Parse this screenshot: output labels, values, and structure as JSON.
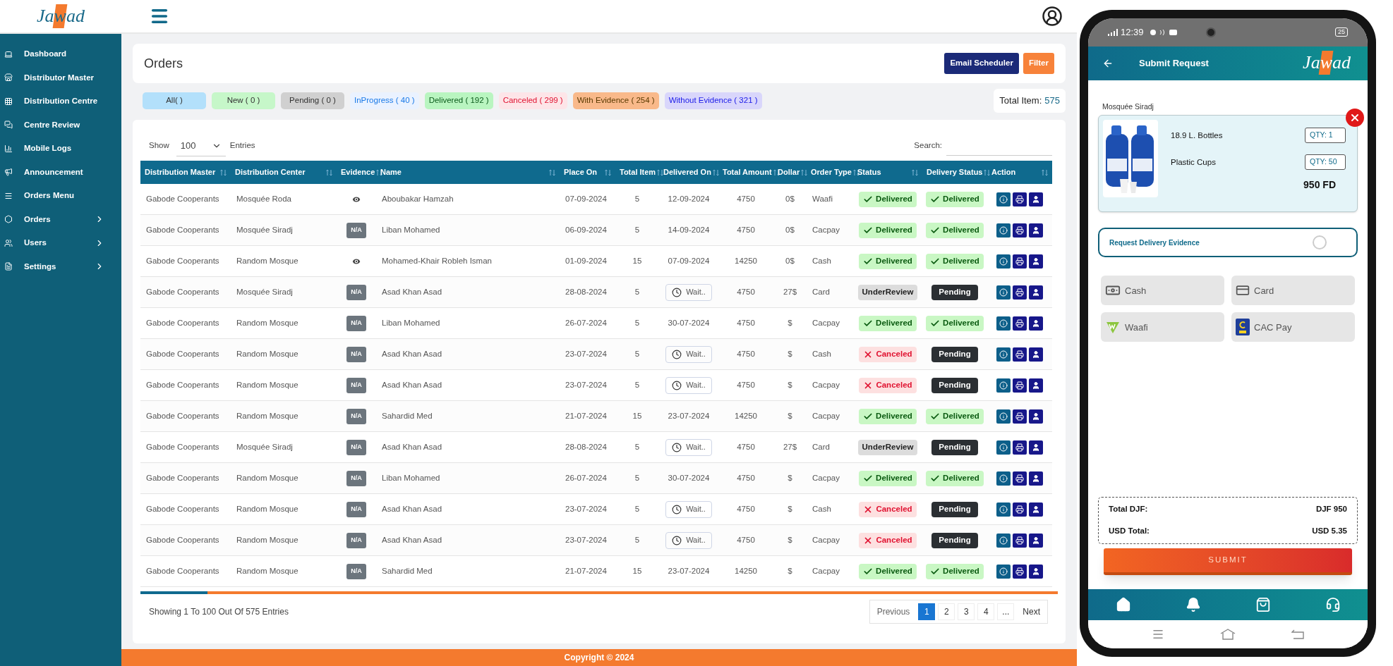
{
  "header": {
    "logo": "Jawad"
  },
  "sidebar": {
    "items": [
      {
        "label": "Dashboard",
        "kind": "link"
      },
      {
        "label": "Distributor Master",
        "kind": "link"
      },
      {
        "label": "Distribution Centre",
        "kind": "link"
      },
      {
        "label": "Centre Review",
        "kind": "link"
      },
      {
        "label": "Mobile Logs",
        "kind": "link"
      },
      {
        "label": "Announcement",
        "kind": "link"
      },
      {
        "label": "Orders Menu",
        "kind": "link"
      },
      {
        "label": "Orders",
        "kind": "submenu"
      },
      {
        "label": "Users",
        "kind": "submenu"
      },
      {
        "label": "Settings",
        "kind": "submenu"
      }
    ]
  },
  "page": {
    "title": "Orders",
    "buttons": [
      {
        "label": "Email Scheduler",
        "kind": "primary"
      },
      {
        "label": "Filter",
        "kind": "accent"
      }
    ]
  },
  "filters": [
    {
      "label": "All( )",
      "kind": "all"
    },
    {
      "label": "New ( 0 )",
      "kind": "new"
    },
    {
      "label": "Pending ( 0 )",
      "kind": "pending"
    },
    {
      "label": "InProgress ( 40 )",
      "kind": "inprogress"
    },
    {
      "label": "Delivered ( 192 )",
      "kind": "delivered"
    },
    {
      "label": "Canceled ( 299 )",
      "kind": "canceled"
    },
    {
      "label": "With Evidence ( 254 )",
      "kind": "with_evidence"
    },
    {
      "label": "Without Evidence ( 321 )",
      "kind": "without_evidence"
    }
  ],
  "total_item": {
    "label": "Total Item:",
    "value": "575"
  },
  "table_controls": {
    "show_label": "Show",
    "page_size": "100",
    "entries_label": "Entries",
    "search_label": "Search:"
  },
  "table": {
    "columns": [
      "Distribution Master",
      "Distribution Center",
      "Evidence",
      "Name",
      "Place On",
      "Total Item",
      "Delivered On",
      "Total Amount",
      "Dollar",
      "Order Type",
      "Status",
      "Delivery Status",
      "Action"
    ],
    "rows": [
      {
        "master": "Gabode Cooperants",
        "center": "Mosquée Roda",
        "evidence": {
          "kind": "eye"
        },
        "name": "Aboubakar Hamzah",
        "place_on": "07-09-2024",
        "total_item": "5",
        "delivered_on": {
          "kind": "date",
          "text": "12-09-2024"
        },
        "total_amount": "4750",
        "dollar": "0$",
        "order_type": "Waafi",
        "status": {
          "kind": "delivered",
          "text": "Delivered"
        },
        "delivery_status": {
          "kind": "delivered",
          "text": "Delivered"
        }
      },
      {
        "master": "Gabode Cooperants",
        "center": "Mosquée Siradj",
        "evidence": {
          "kind": "badge",
          "text": "N/A"
        },
        "name": "Liban Mohamed",
        "place_on": "06-09-2024",
        "total_item": "5",
        "delivered_on": {
          "kind": "date",
          "text": "14-09-2024"
        },
        "total_amount": "4750",
        "dollar": "0$",
        "order_type": "Cacpay",
        "status": {
          "kind": "delivered",
          "text": "Delivered"
        },
        "delivery_status": {
          "kind": "delivered",
          "text": "Delivered"
        }
      },
      {
        "master": "Gabode Cooperants",
        "center": "Random Mosque",
        "evidence": {
          "kind": "eye"
        },
        "name": "Mohamed-Khair Robleh Isman",
        "place_on": "01-09-2024",
        "total_item": "15",
        "delivered_on": {
          "kind": "date",
          "text": "07-09-2024"
        },
        "total_amount": "14250",
        "dollar": "0$",
        "order_type": "Cash",
        "status": {
          "kind": "delivered",
          "text": "Delivered"
        },
        "delivery_status": {
          "kind": "delivered",
          "text": "Delivered"
        }
      },
      {
        "master": "Gabode Cooperants",
        "center": "Mosquée Siradj",
        "evidence": {
          "kind": "badge",
          "text": "N/A"
        },
        "name": "Asad Khan Asad",
        "place_on": "28-08-2024",
        "total_item": "5",
        "delivered_on": {
          "kind": "waiting",
          "text": "Wait.."
        },
        "total_amount": "4750",
        "dollar": "27$",
        "order_type": "Card",
        "status": {
          "kind": "review",
          "text": "UnderReview"
        },
        "delivery_status": {
          "kind": "pending",
          "text": "Pending"
        }
      },
      {
        "master": "Gabode Cooperants",
        "center": "Random Mosque",
        "evidence": {
          "kind": "badge",
          "text": "N/A"
        },
        "name": "Liban Mohamed",
        "place_on": "26-07-2024",
        "total_item": "5",
        "delivered_on": {
          "kind": "date",
          "text": "30-07-2024"
        },
        "total_amount": "4750",
        "dollar": "$",
        "order_type": "Cacpay",
        "status": {
          "kind": "delivered",
          "text": "Delivered"
        },
        "delivery_status": {
          "kind": "delivered",
          "text": "Delivered"
        }
      },
      {
        "master": "Gabode Cooperants",
        "center": "Random Mosque",
        "evidence": {
          "kind": "badge",
          "text": "N/A"
        },
        "name": "Asad Khan Asad",
        "place_on": "23-07-2024",
        "total_item": "5",
        "delivered_on": {
          "kind": "waiting",
          "text": "Wait.."
        },
        "total_amount": "4750",
        "dollar": "$",
        "order_type": "Cash",
        "status": {
          "kind": "canceled",
          "text": "Canceled"
        },
        "delivery_status": {
          "kind": "pending",
          "text": "Pending"
        }
      },
      {
        "master": "Gabode Cooperants",
        "center": "Random Mosque",
        "evidence": {
          "kind": "badge",
          "text": "N/A"
        },
        "name": "Asad Khan Asad",
        "place_on": "23-07-2024",
        "total_item": "5",
        "delivered_on": {
          "kind": "waiting",
          "text": "Wait.."
        },
        "total_amount": "4750",
        "dollar": "$",
        "order_type": "Cacpay",
        "status": {
          "kind": "canceled",
          "text": "Canceled"
        },
        "delivery_status": {
          "kind": "pending",
          "text": "Pending"
        }
      },
      {
        "master": "Gabode Cooperants",
        "center": "Random Mosque",
        "evidence": {
          "kind": "badge",
          "text": "N/A"
        },
        "name": "Sahardid Med",
        "place_on": "21-07-2024",
        "total_item": "15",
        "delivered_on": {
          "kind": "date",
          "text": "23-07-2024"
        },
        "total_amount": "14250",
        "dollar": "$",
        "order_type": "Cacpay",
        "status": {
          "kind": "delivered",
          "text": "Delivered"
        },
        "delivery_status": {
          "kind": "delivered",
          "text": "Delivered"
        }
      },
      {
        "master": "Gabode Cooperants",
        "center": "Mosquée Siradj",
        "evidence": {
          "kind": "badge",
          "text": "N/A"
        },
        "name": "Asad Khan Asad",
        "place_on": "28-08-2024",
        "total_item": "5",
        "delivered_on": {
          "kind": "waiting",
          "text": "Wait.."
        },
        "total_amount": "4750",
        "dollar": "27$",
        "order_type": "Card",
        "status": {
          "kind": "review",
          "text": "UnderReview"
        },
        "delivery_status": {
          "kind": "pending",
          "text": "Pending"
        }
      },
      {
        "master": "Gabode Cooperants",
        "center": "Random Mosque",
        "evidence": {
          "kind": "badge",
          "text": "N/A"
        },
        "name": "Liban Mohamed",
        "place_on": "26-07-2024",
        "total_item": "5",
        "delivered_on": {
          "kind": "date",
          "text": "30-07-2024"
        },
        "total_amount": "4750",
        "dollar": "$",
        "order_type": "Cacpay",
        "status": {
          "kind": "delivered",
          "text": "Delivered"
        },
        "delivery_status": {
          "kind": "delivered",
          "text": "Delivered"
        }
      },
      {
        "master": "Gabode Cooperants",
        "center": "Random Mosque",
        "evidence": {
          "kind": "badge",
          "text": "N/A"
        },
        "name": "Asad Khan Asad",
        "place_on": "23-07-2024",
        "total_item": "5",
        "delivered_on": {
          "kind": "waiting",
          "text": "Wait.."
        },
        "total_amount": "4750",
        "dollar": "$",
        "order_type": "Cash",
        "status": {
          "kind": "canceled",
          "text": "Canceled"
        },
        "delivery_status": {
          "kind": "pending",
          "text": "Pending"
        }
      },
      {
        "master": "Gabode Cooperants",
        "center": "Random Mosque",
        "evidence": {
          "kind": "badge",
          "text": "N/A"
        },
        "name": "Asad Khan Asad",
        "place_on": "23-07-2024",
        "total_item": "5",
        "delivered_on": {
          "kind": "waiting",
          "text": "Wait.."
        },
        "total_amount": "4750",
        "dollar": "$",
        "order_type": "Cacpay",
        "status": {
          "kind": "canceled",
          "text": "Canceled"
        },
        "delivery_status": {
          "kind": "pending",
          "text": "Pending"
        }
      },
      {
        "master": "Gabode Cooperants",
        "center": "Random Mosque",
        "evidence": {
          "kind": "badge",
          "text": "N/A"
        },
        "name": "Sahardid Med",
        "place_on": "21-07-2024",
        "total_item": "15",
        "delivered_on": {
          "kind": "date",
          "text": "23-07-2024"
        },
        "total_amount": "14250",
        "dollar": "$",
        "order_type": "Cacpay",
        "status": {
          "kind": "delivered",
          "text": "Delivered"
        },
        "delivery_status": {
          "kind": "delivered",
          "text": "Delivered"
        }
      }
    ]
  },
  "table_footer": {
    "summary": "Showing 1 To 100 Out Of 575 Entries"
  },
  "pagination": {
    "previous": "Previous",
    "pages": [
      {
        "label": "1",
        "selected": true
      },
      {
        "label": "2",
        "selected": false
      },
      {
        "label": "3",
        "selected": false
      },
      {
        "label": "4",
        "selected": false
      },
      {
        "label": "...",
        "selected": false
      }
    ],
    "next": "Next"
  },
  "footer": {
    "text": "Copyright © 2024"
  },
  "phone": {
    "status_bar": {
      "time": "12:39",
      "battery": "25"
    },
    "app_bar": {
      "title": "Submit Request",
      "logo": "Jawad"
    },
    "location": "Mosquée Siradj",
    "order_card": {
      "items": [
        {
          "name": "18.9 L. Bottles",
          "qty": "QTY: 1"
        },
        {
          "name": "Plastic Cups",
          "qty": "QTY: 50"
        }
      ],
      "price": "950 FD"
    },
    "evidence_toggle": {
      "label": "Request Delivery Evidence",
      "checked": false
    },
    "payments": [
      {
        "label": "Cash",
        "kind": "cash"
      },
      {
        "label": "Card",
        "kind": "card"
      },
      {
        "label": "Waafi",
        "kind": "waafi"
      },
      {
        "label": "CAC Pay",
        "kind": "cacpay"
      }
    ],
    "totals": [
      {
        "label": "Total DJF:",
        "value": "DJF 950"
      },
      {
        "label": "USD Total:",
        "value": "USD 5.35"
      }
    ],
    "submit": "SUBMIT"
  }
}
